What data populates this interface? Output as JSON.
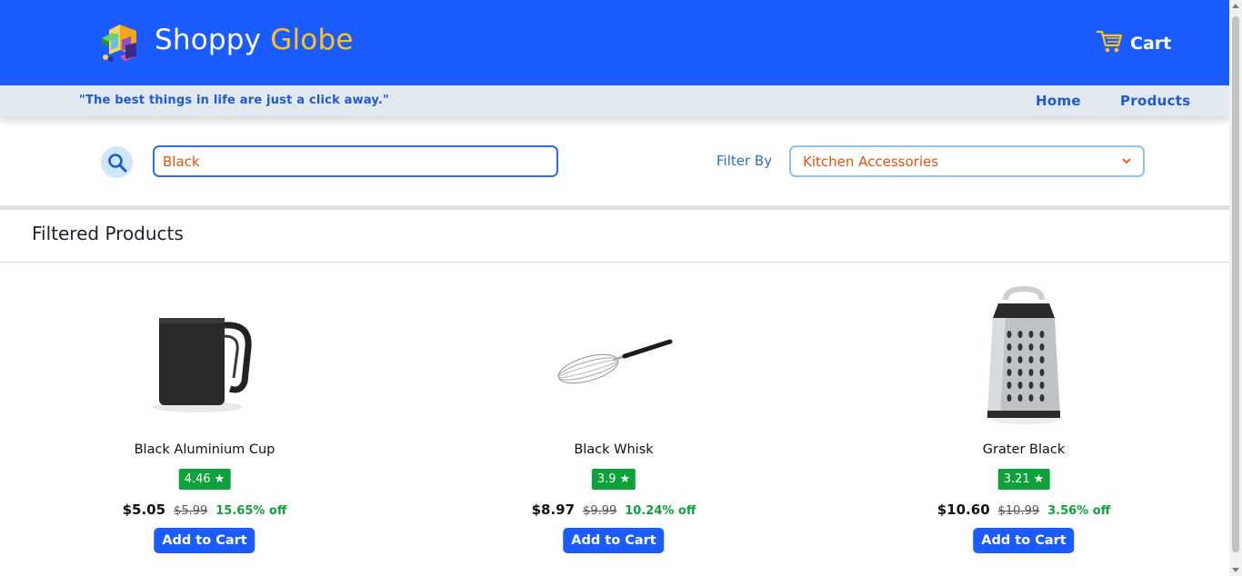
{
  "header": {
    "brand_primary": "Shoppy",
    "brand_accent": "Globe",
    "cart_label": "Cart",
    "cart_icon": "cart-icon",
    "logo_icon": "shoppy-globe-logo"
  },
  "subbar": {
    "tagline": "\"The best things in life are just a click away.\"",
    "nav": [
      "Home",
      "Products"
    ]
  },
  "search": {
    "icon": "search-icon",
    "value": "Black"
  },
  "filter": {
    "label": "Filter By",
    "selected": "Kitchen Accessories"
  },
  "section": {
    "title": "Filtered Products"
  },
  "products": [
    {
      "name": "Black Aluminium Cup",
      "rating": "4.46",
      "price": "$5.05",
      "old_price": "$5.99",
      "discount": "15.65% off",
      "button": "Add to Cart",
      "icon": "mug-icon"
    },
    {
      "name": "Black Whisk",
      "rating": "3.9",
      "price": "$8.97",
      "old_price": "$9.99",
      "discount": "10.24% off",
      "button": "Add to Cart",
      "icon": "whisk-icon"
    },
    {
      "name": "Grater Black",
      "rating": "3.21",
      "price": "$10.60",
      "old_price": "$10.99",
      "discount": "3.56% off",
      "button": "Add to Cart",
      "icon": "grater-icon"
    }
  ],
  "colors": {
    "primary": "#1a5cff",
    "accent": "#ffc21a",
    "rating_green": "#0ea23a",
    "orange_text": "#e6520c"
  }
}
